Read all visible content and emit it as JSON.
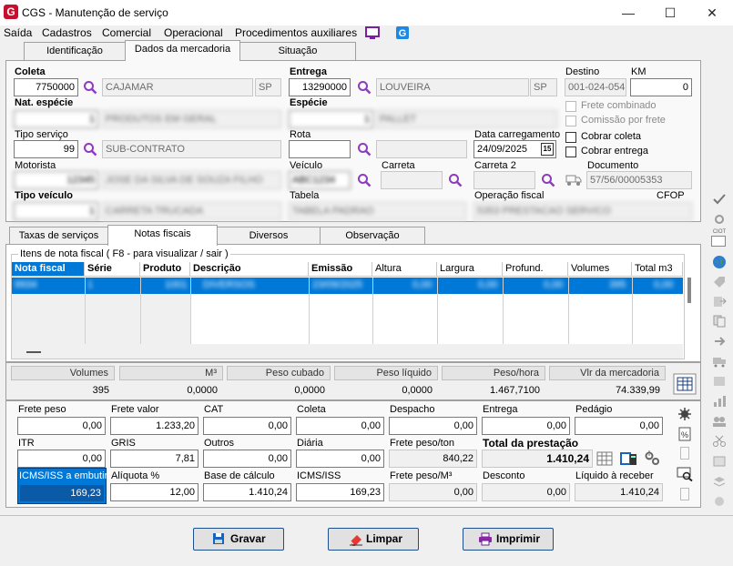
{
  "window": {
    "title": "CGS - Manutenção de serviço",
    "minimize": "—",
    "maximize": "☐",
    "close": "✕"
  },
  "menu": [
    "Saída",
    "Cadastros",
    "Comercial",
    "Operacional",
    "Procedimentos auxiliares"
  ],
  "top_tabs": [
    {
      "label": "Identificação"
    },
    {
      "label": "Dados da mercadoria"
    },
    {
      "label": "Situação"
    }
  ],
  "form": {
    "coleta": {
      "label": "Coleta",
      "code": "7750000",
      "city": "CAJAMAR",
      "uf": "SP"
    },
    "entrega": {
      "label": "Entrega",
      "code": "13290000",
      "city": "LOUVEIRA",
      "uf": "SP"
    },
    "destino": {
      "label": "Destino",
      "value": "001-024-054"
    },
    "km": {
      "label": "KM",
      "value": "0"
    },
    "nat_especie": {
      "label": "Nat. espécie",
      "code": "1",
      "desc": "PRODUTOS EM GERAL"
    },
    "especie": {
      "label": "Espécie",
      "code": "1",
      "desc": "PALLET"
    },
    "frete_combinado": "Frete combinado",
    "comissao_por_frete": "Comissão por frete",
    "tipo_servico": {
      "label": "Tipo serviço",
      "code": "99",
      "desc": "SUB-CONTRATO"
    },
    "rota": {
      "label": "Rota",
      "value": ""
    },
    "data_carregamento": {
      "label": "Data carregamento",
      "value": "24/09/2025",
      "cal": "15"
    },
    "cobrar_coleta": "Cobrar coleta",
    "cobrar_entrega": "Cobrar entrega",
    "motorista": {
      "label": "Motorista",
      "code": "12345",
      "name": "JOSE DA SILVA DE SOUZA FILHO"
    },
    "veiculo": {
      "label": "Veículo",
      "value": "ABC1234"
    },
    "carreta": {
      "label": "Carreta",
      "value": ""
    },
    "carreta2": {
      "label": "Carreta 2",
      "value": ""
    },
    "documento": {
      "label": "Documento",
      "value": "57/56/00005353"
    },
    "tipo_veiculo": {
      "label": "Tipo veículo",
      "code": "1",
      "desc": "CARRETA TRUCADA"
    },
    "tabela": {
      "label": "Tabela",
      "value": "TABELA PADRAO"
    },
    "operacao_fiscal": {
      "label": "Operação fiscal",
      "value": "5353 PRESTACAO SERVICO"
    },
    "cfop": {
      "label": "CFOP"
    }
  },
  "mid_tabs": [
    {
      "label": "Taxas de serviços"
    },
    {
      "label": "Notas fiscais"
    },
    {
      "label": "Diversos"
    },
    {
      "label": "Observação"
    }
  ],
  "nf": {
    "group_label": "Itens de nota fiscal ( F8 - para visualizar / sair )",
    "columns": [
      "Nota fiscal",
      "Série",
      "Produto",
      "Descrição",
      "Emissão",
      "Altura",
      "Largura",
      "Profund.",
      "Volumes",
      "Total m3"
    ],
    "row": [
      "9934",
      "1",
      "1001",
      "DIVERSOS",
      "23/09/2025",
      "0,00",
      "0,00",
      "0,00",
      "395",
      "0,00"
    ]
  },
  "totals": {
    "headers": [
      "Volumes",
      "M³",
      "Peso cubado",
      "Peso líquido",
      "Peso/hora",
      "Vlr da mercadoria"
    ],
    "values": [
      "395",
      "0,0000",
      "0,0000",
      "0,0000",
      "1.467,7100",
      "74.339,99"
    ]
  },
  "frete": {
    "frete_peso": {
      "label": "Frete peso",
      "value": "0,00"
    },
    "frete_valor": {
      "label": "Frete valor",
      "value": "1.233,20"
    },
    "cat": {
      "label": "CAT",
      "value": "0,00"
    },
    "coleta": {
      "label": "Coleta",
      "value": "0,00"
    },
    "despacho": {
      "label": "Despacho",
      "value": "0,00"
    },
    "entrega": {
      "label": "Entrega",
      "value": "0,00"
    },
    "pedagio": {
      "label": "Pedágio",
      "value": "0,00"
    },
    "itr": {
      "label": "ITR",
      "value": "0,00"
    },
    "gris": {
      "label": "GRIS",
      "value": "7,81"
    },
    "outros": {
      "label": "Outros",
      "value": "0,00"
    },
    "diaria": {
      "label": "Diária",
      "value": "0,00"
    },
    "frete_peso_ton": {
      "label": "Frete peso/ton",
      "value": "840,22"
    },
    "total_prestacao": {
      "label": "Total da prestação",
      "value": "1.410,24"
    },
    "icms_embutir": {
      "label": "ICMS/ISS a embutir",
      "value": "169,23"
    },
    "aliquota": {
      "label": "Alíquota %",
      "value": "12,00"
    },
    "base_calculo": {
      "label": "Base de cálculo",
      "value": "1.410,24"
    },
    "icms_iss": {
      "label": "ICMS/ISS",
      "value": "169,23"
    },
    "frete_peso_m3": {
      "label": "Frete peso/M³",
      "value": "0,00"
    },
    "desconto": {
      "label": "Desconto",
      "value": "0,00"
    },
    "liquido_receber": {
      "label": "Líquido à receber",
      "value": "1.410,24"
    }
  },
  "buttons": {
    "gravar": "Gravar",
    "limpar": "Limpar",
    "imprimir": "Imprimir"
  },
  "colors": {
    "accent": "#0078d7",
    "brand": "#c8102e",
    "search": "#8e3bbf"
  },
  "toolbar_ciot": "CIOT"
}
